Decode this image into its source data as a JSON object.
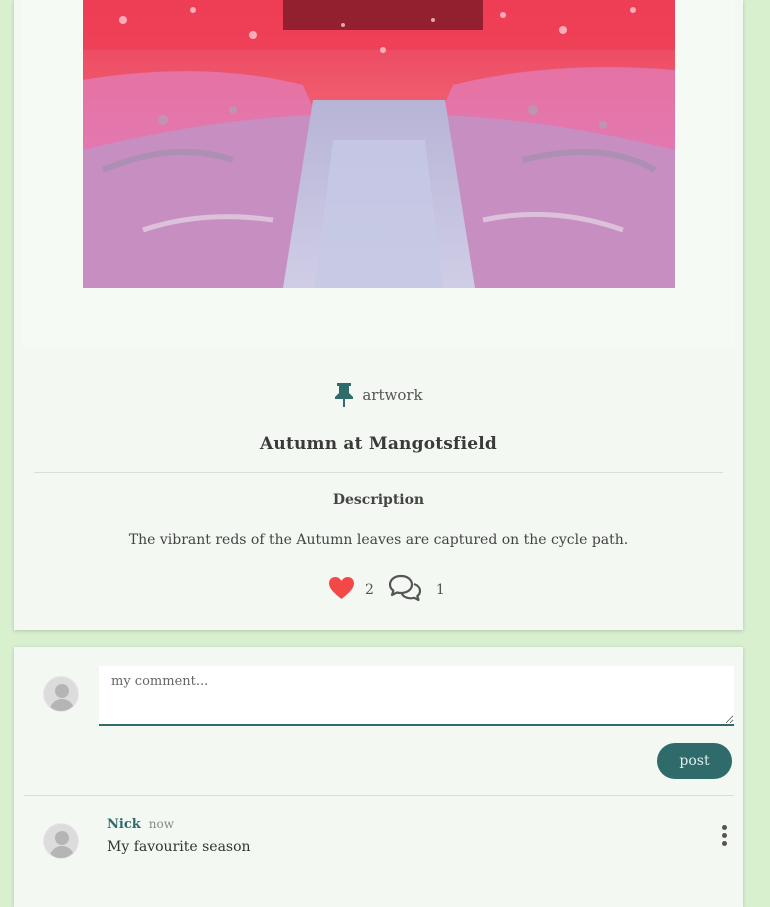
{
  "post": {
    "category_label": "artwork",
    "title": "Autumn at Mangotsfield",
    "description_heading": "Description",
    "description": "The vibrant reds of the Autumn leaves are captured on the cycle path.",
    "like_count": "2",
    "comment_count": "1",
    "colors": {
      "like": "#f24848",
      "accent": "#2f6b6b"
    },
    "icons": {
      "category": "pin-icon",
      "like": "heart-icon",
      "comments": "speech-bubbles-icon"
    }
  },
  "composer": {
    "placeholder": "my comment...",
    "post_label": "post"
  },
  "comments": [
    {
      "author": "Nick",
      "time": "now",
      "text": "My favourite season"
    }
  ]
}
